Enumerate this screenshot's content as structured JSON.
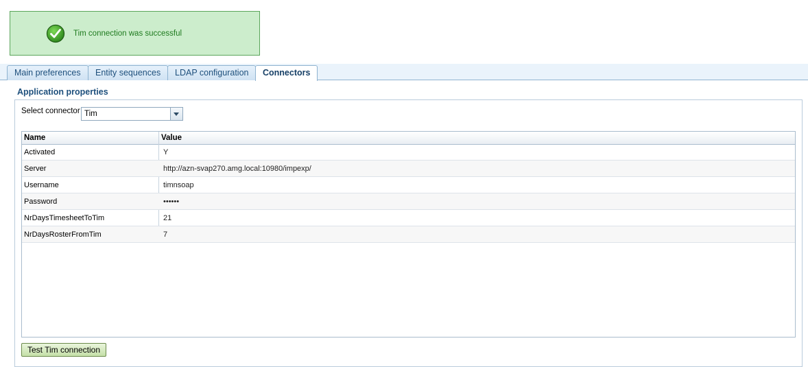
{
  "message": {
    "text": "Tim connection was successful",
    "icon": "check-circle-icon",
    "color": "#1e7a1e"
  },
  "tabs": [
    {
      "label": "Main preferences",
      "active": false
    },
    {
      "label": "Entity sequences",
      "active": false
    },
    {
      "label": "LDAP configuration",
      "active": false
    },
    {
      "label": "Connectors",
      "active": true
    }
  ],
  "section": {
    "title": "Application properties"
  },
  "connector": {
    "label": "Select connector",
    "selected": "Tim"
  },
  "table": {
    "headers": [
      "Name",
      "Value"
    ],
    "rows": [
      {
        "name": "Activated",
        "value": "Y"
      },
      {
        "name": "Server",
        "value": "http://azn-svap270.amg.local:10980/impexp/"
      },
      {
        "name": "Username",
        "value": "timnsoap"
      },
      {
        "name": "Password",
        "value": "••••••"
      },
      {
        "name": "NrDaysTimesheetToTim",
        "value": "21"
      },
      {
        "name": "NrDaysRosterFromTim",
        "value": "7"
      }
    ]
  },
  "actions": {
    "test_label": "Test Tim connection"
  }
}
